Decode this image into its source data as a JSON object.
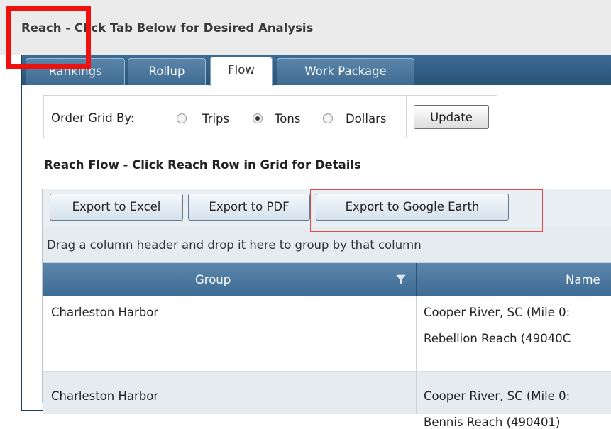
{
  "page": {
    "title": "Reach - Click Tab Below for Desired Analysis"
  },
  "tabs": [
    {
      "label": "Rankings",
      "active": false
    },
    {
      "label": "Rollup",
      "active": false
    },
    {
      "label": "Flow",
      "active": true
    },
    {
      "label": "Work Package",
      "active": false
    }
  ],
  "order": {
    "label": "Order Grid By:",
    "options": [
      {
        "label": "Trips",
        "selected": false
      },
      {
        "label": "Tons",
        "selected": true
      },
      {
        "label": "Dollars",
        "selected": false
      }
    ],
    "update_label": "Update"
  },
  "section_heading": "Reach Flow - Click Reach Row in Grid for Details",
  "toolbar": {
    "export_excel": "Export to Excel",
    "export_pdf": "Export to PDF",
    "export_google_earth": "Export to Google Earth"
  },
  "grid": {
    "group_hint": "Drag a column header and drop it here to group by that column",
    "columns": [
      "Group",
      "Name"
    ],
    "rows": [
      {
        "group": "Charleston Harbor",
        "name_line1": "Cooper River, SC (Mile 0:",
        "name_line2": "Rebellion Reach (49040C"
      },
      {
        "group": "Charleston Harbor",
        "name_line1": "Cooper River, SC (Mile 0:",
        "name_line2": "Bennis Reach (490401)"
      }
    ]
  },
  "colors": {
    "tab_strip": "#2f5a80",
    "header_row": "#4b7aa3",
    "alt_row": "#e6ebf0",
    "annotation_red": "#ef1010"
  }
}
